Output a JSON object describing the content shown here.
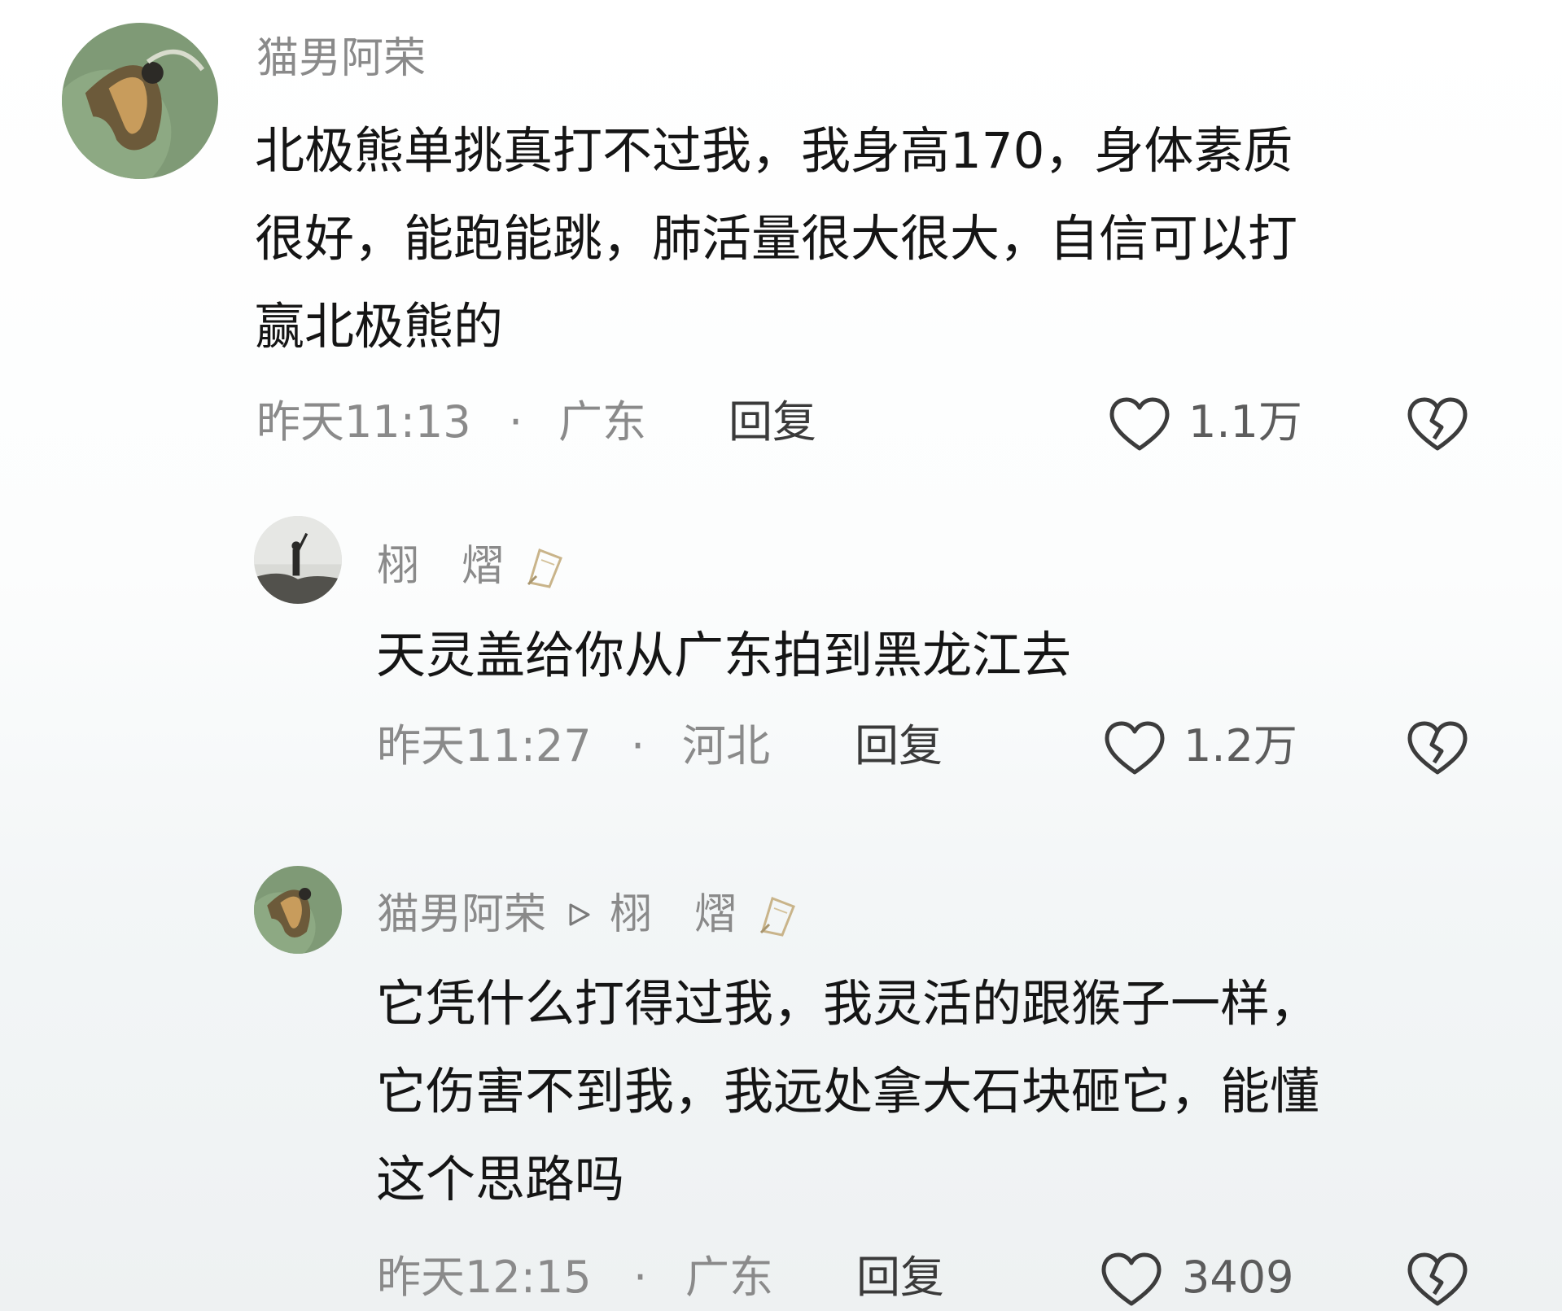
{
  "comments": [
    {
      "username": "猫男阿荣",
      "body_lines": [
        "北极熊单挑真打不过我，我身高170，身体素质",
        "很好，能跑能跳，肺活量很大很大，自信可以打",
        "赢北极熊的"
      ],
      "time": "昨天11:13",
      "separator": "·",
      "location": "广东",
      "reply_label": "回复",
      "likes": "1.1万"
    },
    {
      "username": "栩　熠",
      "body_lines": [
        "天灵盖给你从广东拍到黑龙江去"
      ],
      "time": "昨天11:27",
      "separator": "·",
      "location": "河北",
      "reply_label": "回复",
      "likes": "1.2万"
    },
    {
      "username": "猫男阿荣",
      "reply_to": "栩　熠",
      "body_lines": [
        "它凭什么打得过我，我灵活的跟猴子一样，",
        "它伤害不到我，我远处拿大石块砸它，能懂",
        "这个思路吗"
      ],
      "time": "昨天12:15",
      "separator": "·",
      "location": "广东",
      "reply_label": "回复",
      "likes": "3409"
    }
  ],
  "icons": {
    "like": "heart-outline-icon",
    "dislike": "broken-heart-icon",
    "reply_arrow": "play-triangle-icon",
    "badge": "pencil-badge-icon"
  },
  "colors": {
    "username": "#8a8a8a",
    "body": "#151515",
    "meta": "#8a8a8a",
    "reply": "#3a3a3a"
  }
}
